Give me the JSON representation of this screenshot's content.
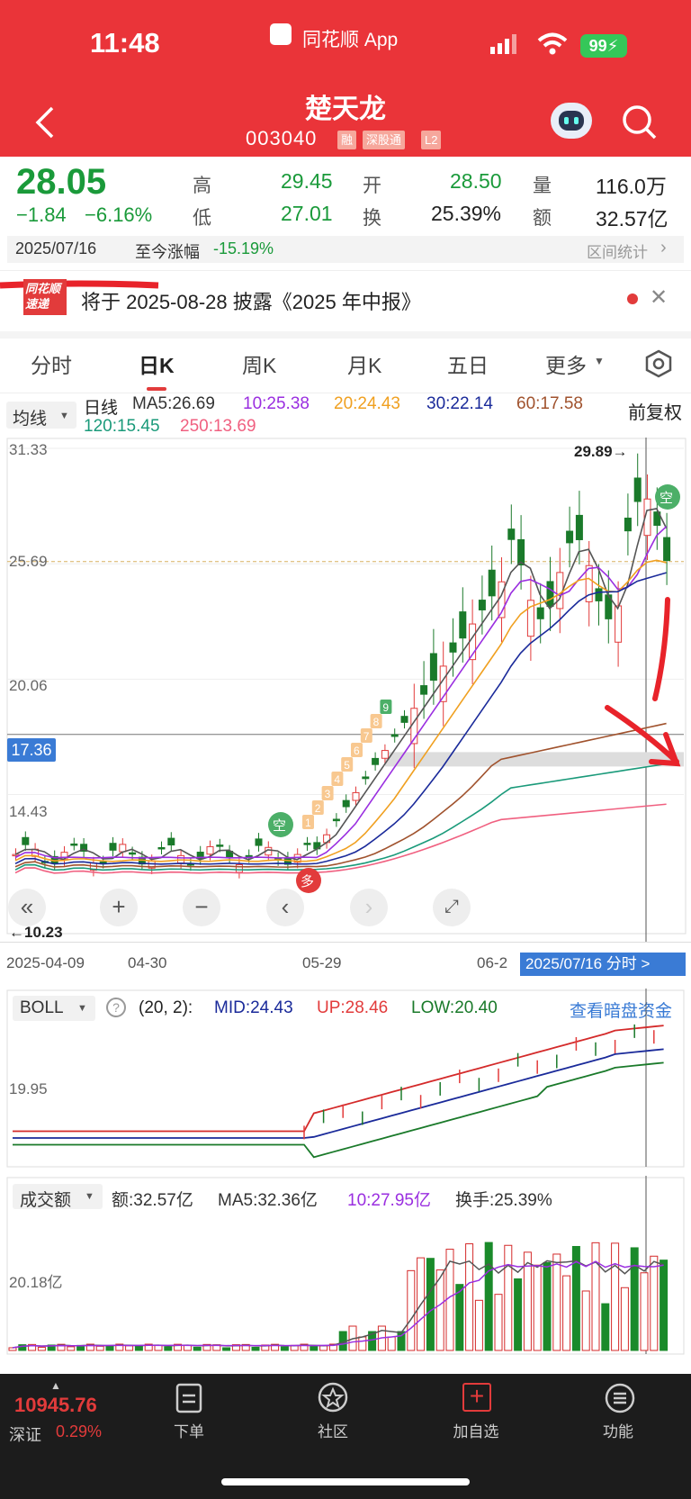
{
  "status_bar": {
    "time": "11:48",
    "app_name": "同花顺 App",
    "battery": "99"
  },
  "header": {
    "title": "楚天龙",
    "code": "003040",
    "tags": [
      "融",
      "深股通",
      "L2"
    ]
  },
  "quote": {
    "price": "28.05",
    "change": "−1.84",
    "change_pct": "−6.16%",
    "high_label": "高",
    "high": "29.45",
    "low_label": "低",
    "low": "27.01",
    "open_label": "开",
    "open": "28.50",
    "turnover_label": "换",
    "turnover": "25.39%",
    "volume_label": "量",
    "volume": "116.0万",
    "amount_label": "额",
    "amount": "32.57亿",
    "date": "2025/07/16",
    "since_label": "至今涨幅",
    "since_value": "-15.19%",
    "interval_stats": "区间统计"
  },
  "notice": {
    "badge": "同花顺 速递",
    "text": "将于 2025-08-28 披露《2025 年中报》"
  },
  "tabs": [
    "分时",
    "日K",
    "周K",
    "月K",
    "五日",
    "更多"
  ],
  "active_tab": "日K",
  "kline_header": {
    "mode": "均线",
    "line_label": "日线",
    "adjust": "前复权",
    "ma": [
      {
        "label": "MA5:26.69",
        "color": "#333333"
      },
      {
        "label": "10:25.38",
        "color": "#9a2ee0"
      },
      {
        "label": "20:24.43",
        "color": "#f0a020"
      },
      {
        "label": "30:22.14",
        "color": "#1a2a9a"
      },
      {
        "label": "60:17.58",
        "color": "#a0522d"
      },
      {
        "label": "120:15.45",
        "color": "#1a9a7a"
      },
      {
        "label": "250:13.69",
        "color": "#f06080"
      }
    ]
  },
  "kline": {
    "y_ticks": [
      "31.33",
      "25.69",
      "20.06",
      "14.43"
    ],
    "current_line_label": "17.36",
    "max_label": "29.89→",
    "min_label": "←10.23",
    "x_labels": [
      "2025-04-09",
      "04-30",
      "05-29",
      "06-2"
    ],
    "cursor_label": "2025/07/16 分时 >",
    "signal_empty": "空",
    "signal_more": "多",
    "counter_labels": [
      "1",
      "2",
      "3",
      "4",
      "5",
      "6",
      "7",
      "8",
      "9"
    ],
    "price_range": [
      10.23,
      31.33
    ]
  },
  "boll": {
    "label": "BOLL",
    "param": "(20, 2):",
    "mid": "MID:24.43",
    "up": "UP:28.46",
    "low": "LOW:20.40",
    "y_tick": "19.95",
    "link": "查看暗盘资金"
  },
  "volume_panel": {
    "label": "成交额",
    "amount": "额:32.57亿",
    "ma5": "MA5:32.36亿",
    "ma10": "10:27.95亿",
    "turnover": "换手:25.39%",
    "y_tick": "20.18亿"
  },
  "bottom_bar": {
    "index_value": "10945.76",
    "index_name": "深证",
    "index_change": "0.29%",
    "items": [
      "下单",
      "社区",
      "加自选",
      "功能"
    ]
  },
  "chart_data": {
    "type": "candlestick",
    "title": "",
    "y_range": [
      10.23,
      31.33
    ],
    "x_labels": [
      "2025-04-09",
      "04-30",
      "05-29",
      "06-2"
    ],
    "note_values": {
      "max": 29.89,
      "min": 10.23,
      "current": 28.05
    }
  }
}
